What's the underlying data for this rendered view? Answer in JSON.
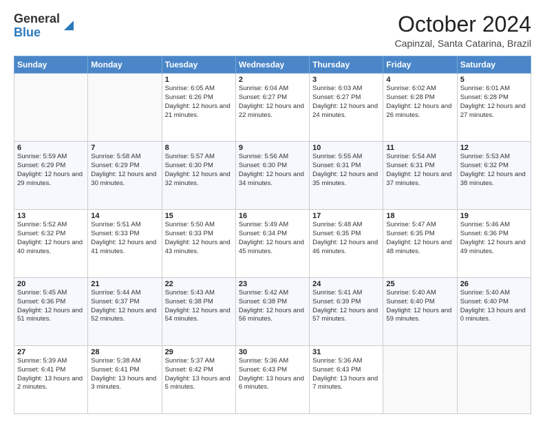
{
  "header": {
    "logo_general": "General",
    "logo_blue": "Blue",
    "month_title": "October 2024",
    "location": "Capinzal, Santa Catarina, Brazil"
  },
  "days_of_week": [
    "Sunday",
    "Monday",
    "Tuesday",
    "Wednesday",
    "Thursday",
    "Friday",
    "Saturday"
  ],
  "weeks": [
    [
      {
        "day": "",
        "sunrise": "",
        "sunset": "",
        "daylight": "",
        "empty": true
      },
      {
        "day": "",
        "sunrise": "",
        "sunset": "",
        "daylight": "",
        "empty": true
      },
      {
        "day": "1",
        "sunrise": "Sunrise: 6:05 AM",
        "sunset": "Sunset: 6:26 PM",
        "daylight": "Daylight: 12 hours and 21 minutes.",
        "empty": false
      },
      {
        "day": "2",
        "sunrise": "Sunrise: 6:04 AM",
        "sunset": "Sunset: 6:27 PM",
        "daylight": "Daylight: 12 hours and 22 minutes.",
        "empty": false
      },
      {
        "day": "3",
        "sunrise": "Sunrise: 6:03 AM",
        "sunset": "Sunset: 6:27 PM",
        "daylight": "Daylight: 12 hours and 24 minutes.",
        "empty": false
      },
      {
        "day": "4",
        "sunrise": "Sunrise: 6:02 AM",
        "sunset": "Sunset: 6:28 PM",
        "daylight": "Daylight: 12 hours and 26 minutes.",
        "empty": false
      },
      {
        "day": "5",
        "sunrise": "Sunrise: 6:01 AM",
        "sunset": "Sunset: 6:28 PM",
        "daylight": "Daylight: 12 hours and 27 minutes.",
        "empty": false
      }
    ],
    [
      {
        "day": "6",
        "sunrise": "Sunrise: 5:59 AM",
        "sunset": "Sunset: 6:29 PM",
        "daylight": "Daylight: 12 hours and 29 minutes.",
        "empty": false
      },
      {
        "day": "7",
        "sunrise": "Sunrise: 5:58 AM",
        "sunset": "Sunset: 6:29 PM",
        "daylight": "Daylight: 12 hours and 30 minutes.",
        "empty": false
      },
      {
        "day": "8",
        "sunrise": "Sunrise: 5:57 AM",
        "sunset": "Sunset: 6:30 PM",
        "daylight": "Daylight: 12 hours and 32 minutes.",
        "empty": false
      },
      {
        "day": "9",
        "sunrise": "Sunrise: 5:56 AM",
        "sunset": "Sunset: 6:30 PM",
        "daylight": "Daylight: 12 hours and 34 minutes.",
        "empty": false
      },
      {
        "day": "10",
        "sunrise": "Sunrise: 5:55 AM",
        "sunset": "Sunset: 6:31 PM",
        "daylight": "Daylight: 12 hours and 35 minutes.",
        "empty": false
      },
      {
        "day": "11",
        "sunrise": "Sunrise: 5:54 AM",
        "sunset": "Sunset: 6:31 PM",
        "daylight": "Daylight: 12 hours and 37 minutes.",
        "empty": false
      },
      {
        "day": "12",
        "sunrise": "Sunrise: 5:53 AM",
        "sunset": "Sunset: 6:32 PM",
        "daylight": "Daylight: 12 hours and 38 minutes.",
        "empty": false
      }
    ],
    [
      {
        "day": "13",
        "sunrise": "Sunrise: 5:52 AM",
        "sunset": "Sunset: 6:32 PM",
        "daylight": "Daylight: 12 hours and 40 minutes.",
        "empty": false
      },
      {
        "day": "14",
        "sunrise": "Sunrise: 5:51 AM",
        "sunset": "Sunset: 6:33 PM",
        "daylight": "Daylight: 12 hours and 41 minutes.",
        "empty": false
      },
      {
        "day": "15",
        "sunrise": "Sunrise: 5:50 AM",
        "sunset": "Sunset: 6:33 PM",
        "daylight": "Daylight: 12 hours and 43 minutes.",
        "empty": false
      },
      {
        "day": "16",
        "sunrise": "Sunrise: 5:49 AM",
        "sunset": "Sunset: 6:34 PM",
        "daylight": "Daylight: 12 hours and 45 minutes.",
        "empty": false
      },
      {
        "day": "17",
        "sunrise": "Sunrise: 5:48 AM",
        "sunset": "Sunset: 6:35 PM",
        "daylight": "Daylight: 12 hours and 46 minutes.",
        "empty": false
      },
      {
        "day": "18",
        "sunrise": "Sunrise: 5:47 AM",
        "sunset": "Sunset: 6:35 PM",
        "daylight": "Daylight: 12 hours and 48 minutes.",
        "empty": false
      },
      {
        "day": "19",
        "sunrise": "Sunrise: 5:46 AM",
        "sunset": "Sunset: 6:36 PM",
        "daylight": "Daylight: 12 hours and 49 minutes.",
        "empty": false
      }
    ],
    [
      {
        "day": "20",
        "sunrise": "Sunrise: 5:45 AM",
        "sunset": "Sunset: 6:36 PM",
        "daylight": "Daylight: 12 hours and 51 minutes.",
        "empty": false
      },
      {
        "day": "21",
        "sunrise": "Sunrise: 5:44 AM",
        "sunset": "Sunset: 6:37 PM",
        "daylight": "Daylight: 12 hours and 52 minutes.",
        "empty": false
      },
      {
        "day": "22",
        "sunrise": "Sunrise: 5:43 AM",
        "sunset": "Sunset: 6:38 PM",
        "daylight": "Daylight: 12 hours and 54 minutes.",
        "empty": false
      },
      {
        "day": "23",
        "sunrise": "Sunrise: 5:42 AM",
        "sunset": "Sunset: 6:38 PM",
        "daylight": "Daylight: 12 hours and 56 minutes.",
        "empty": false
      },
      {
        "day": "24",
        "sunrise": "Sunrise: 5:41 AM",
        "sunset": "Sunset: 6:39 PM",
        "daylight": "Daylight: 12 hours and 57 minutes.",
        "empty": false
      },
      {
        "day": "25",
        "sunrise": "Sunrise: 5:40 AM",
        "sunset": "Sunset: 6:40 PM",
        "daylight": "Daylight: 12 hours and 59 minutes.",
        "empty": false
      },
      {
        "day": "26",
        "sunrise": "Sunrise: 5:40 AM",
        "sunset": "Sunset: 6:40 PM",
        "daylight": "Daylight: 13 hours and 0 minutes.",
        "empty": false
      }
    ],
    [
      {
        "day": "27",
        "sunrise": "Sunrise: 5:39 AM",
        "sunset": "Sunset: 6:41 PM",
        "daylight": "Daylight: 13 hours and 2 minutes.",
        "empty": false
      },
      {
        "day": "28",
        "sunrise": "Sunrise: 5:38 AM",
        "sunset": "Sunset: 6:41 PM",
        "daylight": "Daylight: 13 hours and 3 minutes.",
        "empty": false
      },
      {
        "day": "29",
        "sunrise": "Sunrise: 5:37 AM",
        "sunset": "Sunset: 6:42 PM",
        "daylight": "Daylight: 13 hours and 5 minutes.",
        "empty": false
      },
      {
        "day": "30",
        "sunrise": "Sunrise: 5:36 AM",
        "sunset": "Sunset: 6:43 PM",
        "daylight": "Daylight: 13 hours and 6 minutes.",
        "empty": false
      },
      {
        "day": "31",
        "sunrise": "Sunrise: 5:36 AM",
        "sunset": "Sunset: 6:43 PM",
        "daylight": "Daylight: 13 hours and 7 minutes.",
        "empty": false
      },
      {
        "day": "",
        "sunrise": "",
        "sunset": "",
        "daylight": "",
        "empty": true
      },
      {
        "day": "",
        "sunrise": "",
        "sunset": "",
        "daylight": "",
        "empty": true
      }
    ]
  ]
}
